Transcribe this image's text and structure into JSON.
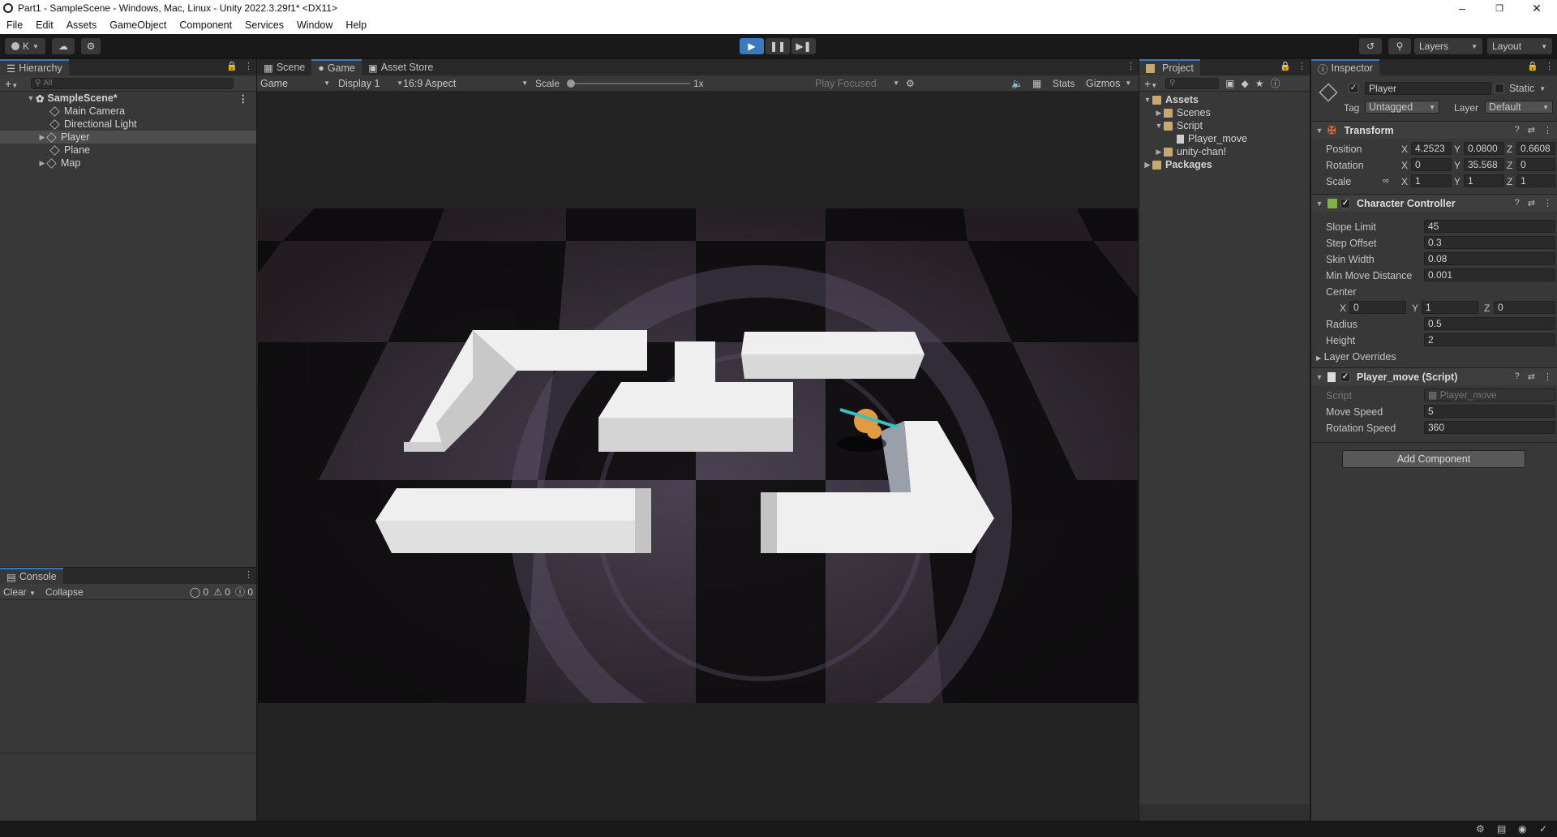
{
  "window": {
    "title": "Part1 - SampleScene - Windows, Mac, Linux - Unity 2022.3.29f1* <DX11>"
  },
  "menu": [
    "File",
    "Edit",
    "Assets",
    "GameObject",
    "Component",
    "Services",
    "Window",
    "Help"
  ],
  "toolbar": {
    "account": "K",
    "layers": "Layers",
    "layout": "Layout"
  },
  "hierarchy": {
    "tab": "Hierarchy",
    "search_placeholder": "All",
    "scene": "SampleScene*",
    "items": [
      "Main Camera",
      "Directional Light",
      "Player",
      "Plane",
      "Map"
    ]
  },
  "console": {
    "tab": "Console",
    "clear": "Clear",
    "collapse": "Collapse",
    "log_count": "0",
    "warn_count": "0",
    "error_count": "0"
  },
  "center_tabs": [
    "Scene",
    "Game",
    "Asset Store"
  ],
  "game_bar": {
    "view": "Game",
    "display": "Display 1",
    "aspect": "16:9 Aspect",
    "scale_label": "Scale",
    "scale_value": "1x",
    "play_focused": "Play Focused",
    "stats": "Stats",
    "gizmos": "Gizmos"
  },
  "project": {
    "tab": "Project",
    "assets": "Assets",
    "scenes": "Scenes",
    "script": "Script",
    "player_move": "Player_move",
    "unitychan": "unity-chan!",
    "packages": "Packages"
  },
  "inspector": {
    "tab": "Inspector",
    "name": "Player",
    "static": "Static",
    "tag_label": "Tag",
    "tag": "Untagged",
    "layer_label": "Layer",
    "layer": "Default",
    "transform": {
      "header": "Transform",
      "position_label": "Position",
      "px": "4.2523",
      "py": "0.0800",
      "pz": "0.6608",
      "rotation_label": "Rotation",
      "rx": "0",
      "ry": "35.568",
      "rz": "0",
      "scale_label": "Scale",
      "sx": "1",
      "sy": "1",
      "sz": "1"
    },
    "cc": {
      "header": "Character Controller",
      "slope_label": "Slope Limit",
      "slope": "45",
      "step_label": "Step Offset",
      "step": "0.3",
      "skin_label": "Skin Width",
      "skin": "0.08",
      "minmove_label": "Min Move Distance",
      "minmove": "0.001",
      "center_label": "Center",
      "cx": "0",
      "cy": "1",
      "cz": "0",
      "radius_label": "Radius",
      "radius": "0.5",
      "height_label": "Height",
      "height": "2",
      "overrides_label": "Layer Overrides"
    },
    "script": {
      "header": "Player_move (Script)",
      "script_label": "Script",
      "script_value": "Player_move",
      "speed_label": "Move Speed",
      "speed": "5",
      "rot_label": "Rotation Speed",
      "rot": "360"
    },
    "add_component": "Add Component"
  }
}
